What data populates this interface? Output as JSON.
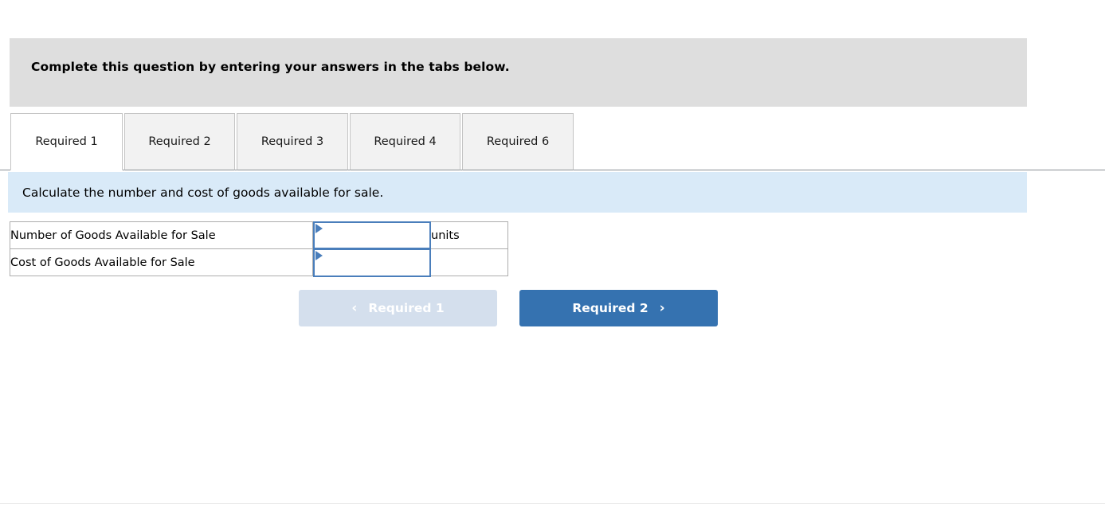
{
  "banner": {
    "text": "Complete this question by entering your answers in the tabs below."
  },
  "tabs": {
    "items": [
      {
        "label": "Required 1",
        "active": true
      },
      {
        "label": "Required 2",
        "active": false
      },
      {
        "label": "Required 3",
        "active": false
      },
      {
        "label": "Required 4",
        "active": false
      },
      {
        "label": "Required 6",
        "active": false
      }
    ]
  },
  "instruction": {
    "text": "Calculate the number and cost of goods available for sale."
  },
  "answer_table": {
    "rows": [
      {
        "label": "Number of Goods Available for Sale",
        "value": "",
        "placeholder": "",
        "unit": "units"
      },
      {
        "label": "Cost of Goods Available for Sale",
        "value": "",
        "placeholder": "",
        "unit": ""
      }
    ]
  },
  "navigation": {
    "prev_label": "Required 1",
    "prev_icon": "chevron-left-icon",
    "prev_chevron": "‹",
    "prev_disabled": true,
    "next_label": "Required 2",
    "next_icon": "chevron-right-icon",
    "next_chevron": "›",
    "next_disabled": false
  },
  "colors": {
    "banner_bg": "#dedede",
    "instruction_bg": "#d9eaf8",
    "next_button_bg": "#3572b0",
    "prev_button_bg": "#d4dfed",
    "input_border": "#4a7ebb",
    "tab_inactive_bg": "#f2f2f2",
    "tab_active_bg": "#ffffff"
  }
}
